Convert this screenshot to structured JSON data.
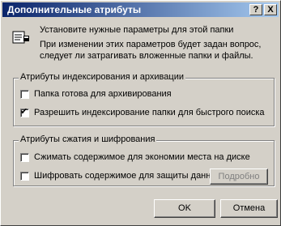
{
  "window": {
    "title": "Дополнительные атрибуты",
    "help_label": "?",
    "close_label": "X"
  },
  "description": {
    "line1": "Установите нужные параметры для этой папки",
    "line2": "При изменении этих параметров будет задан вопрос,",
    "line3": "следует ли затрагивать вложенные папки и файлы."
  },
  "indexing_group": {
    "legend": "Атрибуты индексирования и архивации",
    "archive": {
      "label": "Папка готова для архивирования",
      "checked": false
    },
    "index": {
      "label": "Разрешить индексирование папки для быстрого поиска",
      "checked": true
    }
  },
  "compression_group": {
    "legend": "Атрибуты сжатия и шифрования",
    "compress": {
      "label": "Сжимать содержимое для экономии места на диске",
      "checked": false
    },
    "encrypt": {
      "label": "Шифровать содержимое для защиты данных",
      "checked": false
    },
    "details_label": "Подробно"
  },
  "buttons": {
    "ok": "OK",
    "cancel": "Отмена"
  },
  "icons": {
    "folder": "folder-properties-icon",
    "checkmark": "✔"
  }
}
